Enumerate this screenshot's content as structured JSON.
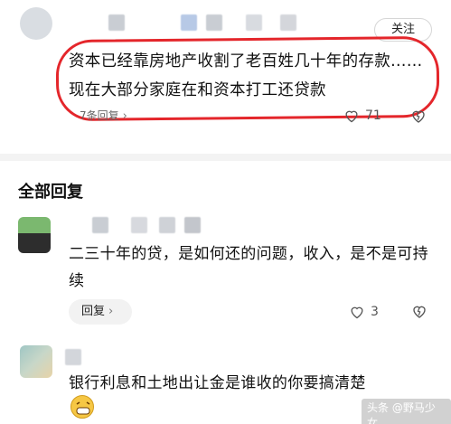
{
  "top_comment": {
    "follow_label": "关注",
    "text": "资本已经靠房地产收割了老百姓几十年的存款……现在大部分家庭在和资本打工还贷款",
    "reply_count_label": "7条回复",
    "like_count": "71"
  },
  "section": {
    "title": "全部回复"
  },
  "replies": [
    {
      "text": "二三十年的贷，是如何还的问题，收入，是不是可持续",
      "reply_button_label": "回复",
      "like_count": "3"
    },
    {
      "text": "银行利息和土地出让金是谁收的你要搞清楚"
    }
  ],
  "watermark": "头条 @野马少女",
  "colors": {
    "highlight_ring": "#e4262b",
    "avatar_green": "#7bb86f"
  }
}
